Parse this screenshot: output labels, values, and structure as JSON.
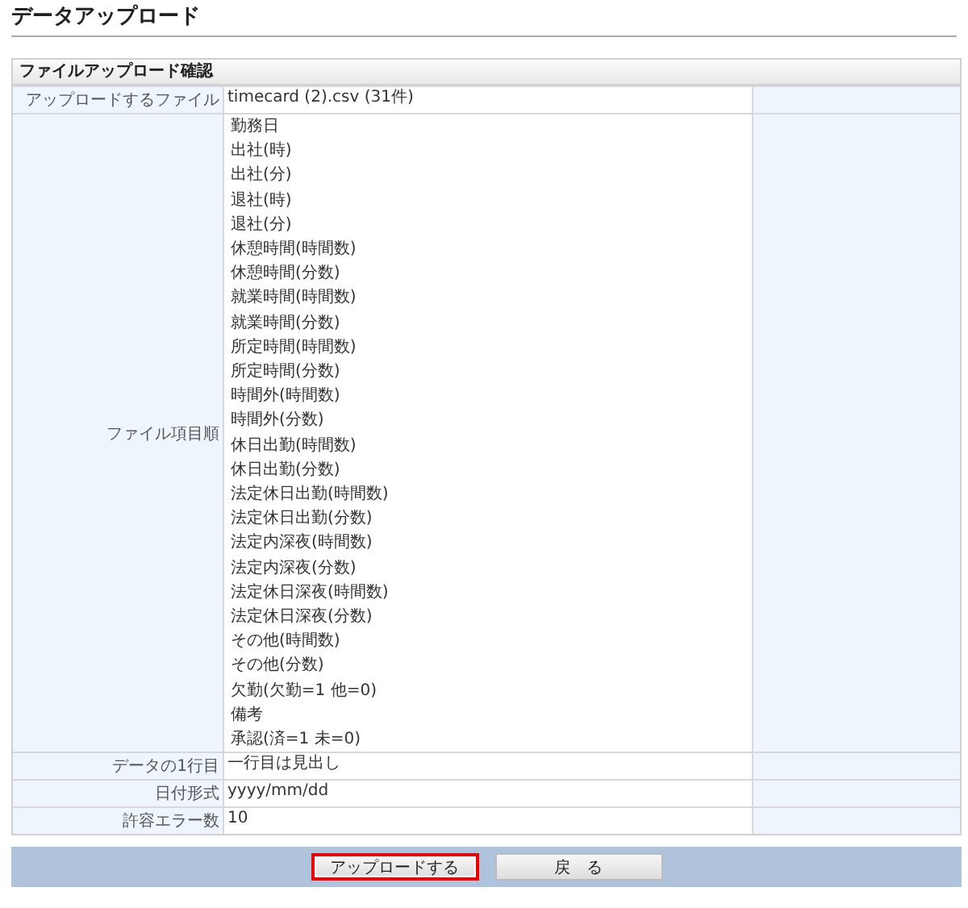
{
  "page_title": "データアップロード",
  "section": {
    "title": "ファイルアップロード確認",
    "rows": [
      {
        "kind": "text",
        "label": "アップロードするファイル",
        "value": "timecard (2).csv  (31件)"
      },
      {
        "kind": "list",
        "label": "ファイル項目順",
        "items": [
          "勤務日",
          "出社(時)",
          "出社(分)",
          "退社(時)",
          "退社(分)",
          "休憩時間(時間数)",
          "休憩時間(分数)",
          "就業時間(時間数)",
          "就業時間(分数)",
          "所定時間(時間数)",
          "所定時間(分数)",
          "時間外(時間数)",
          "時間外(分数)",
          "休日出勤(時間数)",
          "休日出勤(分数)",
          "法定休日出勤(時間数)",
          "法定休日出勤(分数)",
          "法定内深夜(時間数)",
          "法定内深夜(分数)",
          "法定休日深夜(時間数)",
          "法定休日深夜(分数)",
          "その他(時間数)",
          "その他(分数)",
          "欠勤(欠勤=1 他=0)",
          "備考",
          "承認(済=1 未=0)"
        ]
      },
      {
        "kind": "text",
        "label": "データの1行目",
        "value": "一行目は見出し"
      },
      {
        "kind": "text",
        "label": "日付形式",
        "value": "yyyy/mm/dd"
      },
      {
        "kind": "text",
        "label": "許容エラー数",
        "value": "10"
      }
    ]
  },
  "buttons": [
    {
      "label": "アップロードする",
      "focused": true
    },
    {
      "label": "戻　る",
      "focused": false
    }
  ]
}
